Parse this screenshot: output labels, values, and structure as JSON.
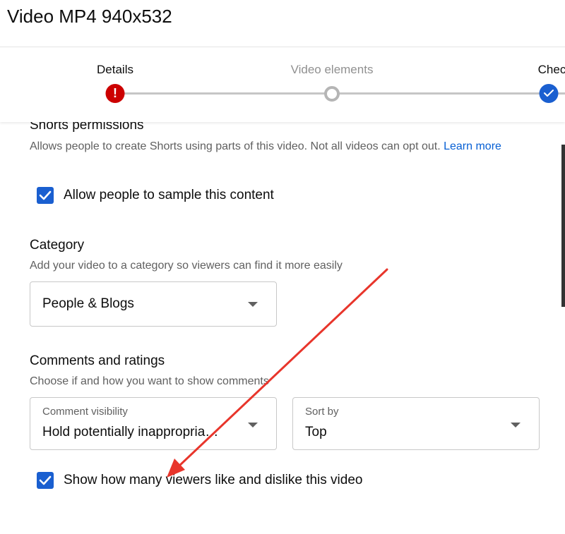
{
  "page": {
    "title": "Video MP4 940x532"
  },
  "stepper": {
    "steps": [
      {
        "label": "Details",
        "state": "error"
      },
      {
        "label": "Video elements",
        "state": "pending"
      },
      {
        "label": "Checks",
        "state": "done"
      }
    ]
  },
  "shorts": {
    "title": "Shorts permissions",
    "description": "Allows people to create Shorts using parts of this video. Not all videos can opt out.",
    "link_text": "Learn more",
    "checkbox_label": "Allow people to sample this content",
    "checked": true
  },
  "category": {
    "title": "Category",
    "description": "Add your video to a category so viewers can find it more easily",
    "selected": "People & Blogs"
  },
  "comments": {
    "title": "Comments and ratings",
    "description": "Choose if and how you want to show comments",
    "visibility_label": "Comment visibility",
    "visibility_value": "Hold potentially inappropria…",
    "sort_label": "Sort by",
    "sort_value": "Top",
    "ratings_checkbox_label": "Show how many viewers like and dislike this video",
    "ratings_checked": true
  },
  "colors": {
    "accent": "#1a5fd0",
    "error": "#cc0000",
    "link": "#065fd4",
    "annotation_arrow": "#e8352b"
  },
  "icons": {
    "error": "exclamation-icon",
    "done": "checkmark-icon",
    "checkbox": "checkmark-icon",
    "dropdown": "caret-down-icon"
  }
}
